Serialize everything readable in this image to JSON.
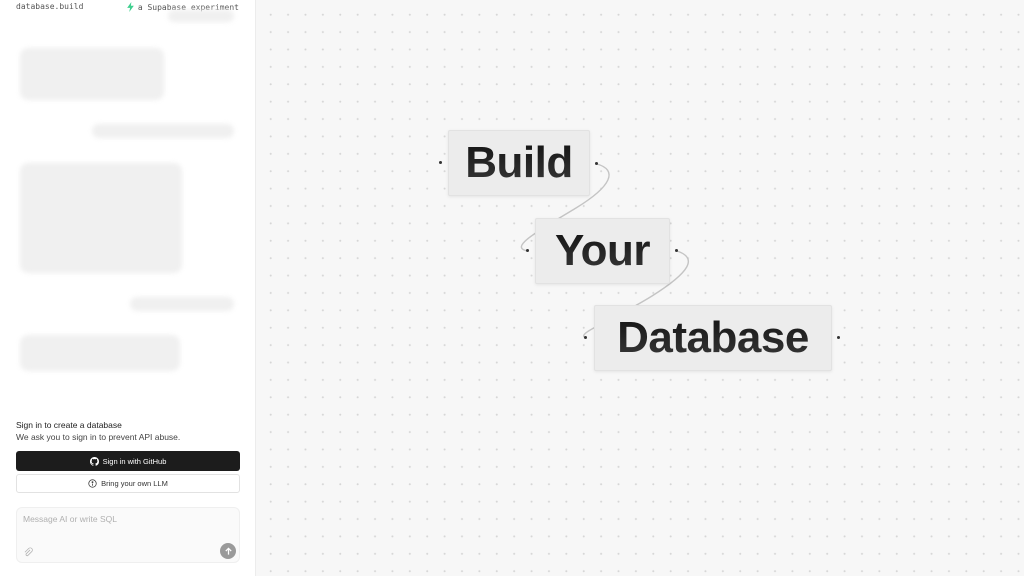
{
  "header": {
    "brand": "database.build",
    "experiment": "a Supabase experiment",
    "experiment_icon": "bolt-icon",
    "accent": "#3ecf8e"
  },
  "signin": {
    "title": "Sign in to create a database",
    "subtitle": "We ask you to sign in to prevent API abuse.",
    "github_button": "Sign in with GitHub",
    "llm_button": "Bring your own LLM"
  },
  "composer": {
    "placeholder": "Message AI or write SQL",
    "value": ""
  },
  "canvas": {
    "words": [
      "Build",
      "Your",
      "Database"
    ]
  }
}
